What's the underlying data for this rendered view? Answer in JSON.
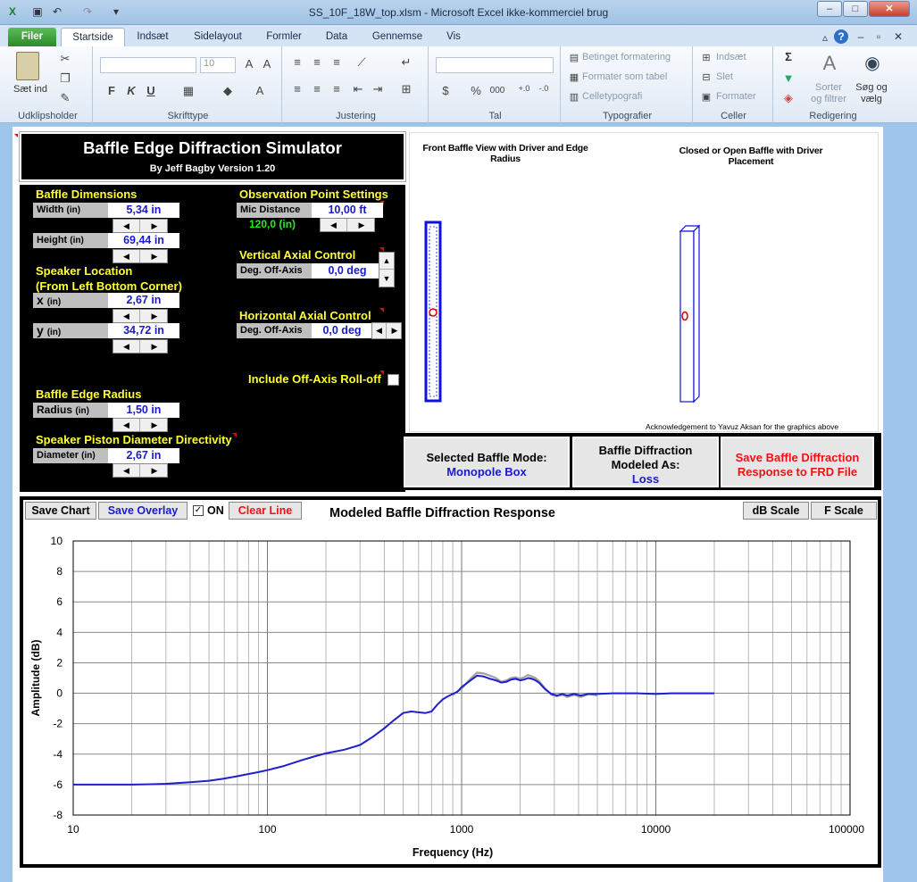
{
  "window": {
    "title": "SS_10F_18W_top.xlsm  -  Microsoft Excel ikke-kommerciel brug",
    "min": "–",
    "max": "□",
    "close": "✕"
  },
  "ribbon": {
    "tabs": [
      "Filer",
      "Startside",
      "Indsæt",
      "Sidelayout",
      "Formler",
      "Data",
      "Gennemse",
      "Vis"
    ],
    "clipboard": {
      "paste": "Sæt ind",
      "label": "Udklipsholder"
    },
    "font": {
      "label": "Skrifttype",
      "size": "10",
      "bold": "F",
      "italic": "K",
      "underline": "U"
    },
    "alignment": {
      "label": "Justering"
    },
    "number": {
      "label": "Tal",
      "percent": "%",
      "thousands": "000"
    },
    "styles": {
      "label": "Typografier",
      "conditional": "Betinget formatering",
      "table": "Formater som tabel",
      "cell_styles": "Celletypografi"
    },
    "cells": {
      "label": "Celler",
      "insert": "Indsæt",
      "delete": "Slet",
      "format": "Formater"
    },
    "editing": {
      "label": "Redigering",
      "sort": "Sorter og filtrer",
      "find": "Søg og vælg",
      "sum": "Σ"
    }
  },
  "sim": {
    "title": "Baffle Edge Diffraction Simulator",
    "byline": "By Jeff Bagby Version 1.20",
    "baffle_dims": "Baffle Dimensions",
    "width_label": "Width",
    "width_unit": "(in)",
    "width_value": "5,34 in",
    "height_label": "Height",
    "height_unit": "(in)",
    "height_value": "69,44 in",
    "speaker_location": "Speaker Location",
    "speaker_location_sub": "(From Left Bottom Corner)",
    "x_label": "x",
    "x_unit": "(in)",
    "x_value": "2,67 in",
    "y_label": "y",
    "y_unit": "(in)",
    "y_value": "34,72 in",
    "edge_radius": "Baffle Edge Radius",
    "radius_label": "Radius",
    "radius_unit": "(in)",
    "radius_value": "1,50 in",
    "piston": "Speaker Piston Diameter Directivity",
    "diameter_label": "Diameter",
    "diameter_unit": "(in)",
    "diameter_value": "2,67 in",
    "obs_settings": "Observation Point Settings",
    "mic_label": "Mic Distance",
    "mic_value": "10,00 ft",
    "mic_inches": "120,0 (in)",
    "vert_control": "Vertical Axial Control",
    "vert_label": "Deg. Off-Axis",
    "vert_value": "0,0 deg",
    "horiz_control": "Horizontal Axial Control",
    "horiz_label": "Deg. Off-Axis",
    "horiz_value": "0,0 deg",
    "rolloff": "Include Off-Axis Roll-off"
  },
  "graphics": {
    "front_caption": "Front Baffle View with Driver and Edge Radius",
    "closed_caption": "Closed or Open Baffle with Driver Placement",
    "ack": "Acknowledgement to Yavuz Aksan for the graphics above"
  },
  "mode": {
    "selected_label": "Selected Baffle Mode:",
    "selected_value": "Monopole Box",
    "modeled_label": "Baffle Diffraction Modeled As:",
    "modeled_value": "Loss",
    "save_frd": "Save Baffle Diffraction Response to FRD File"
  },
  "chart_buttons": {
    "save_chart": "Save Chart",
    "save_overlay": "Save Overlay",
    "on_check": "✓",
    "on_label": "ON",
    "clear_line": "Clear Line",
    "db_scale": "dB Scale",
    "f_scale": "F Scale"
  },
  "colors": {
    "primary_line": "#1f1fcc",
    "overlay_line": "#a0a0a0",
    "accent_yellow": "#ffff33",
    "accent_green": "#22ee22"
  },
  "chart_data": {
    "type": "line",
    "title": "Modeled Baffle Diffraction Response",
    "xlabel": "Frequency (Hz)",
    "ylabel": "Amplitude (dB)",
    "xscale": "log",
    "xlim": [
      10,
      100000
    ],
    "ylim": [
      -8,
      10
    ],
    "xticks": [
      10,
      100,
      1000,
      10000,
      100000
    ],
    "xtick_labels": [
      "10",
      "100",
      "1000",
      "10000",
      "100000"
    ],
    "yticks": [
      -8,
      -6,
      -4,
      -2,
      0,
      2,
      4,
      6,
      8,
      10
    ],
    "ytick_labels": [
      "-8",
      "-6",
      "-4",
      "-2",
      "0",
      "2",
      "4",
      "6",
      "8",
      "10"
    ],
    "grid": true,
    "series": [
      {
        "role": "overlay",
        "color": "#a0a0a0",
        "x": [
          900,
          1000,
          1100,
          1200,
          1300,
          1400,
          1500,
          1600,
          1700,
          1800,
          1900,
          2000,
          2100,
          2200,
          2300,
          2400,
          2500,
          2700,
          2900,
          3100,
          3300,
          3500,
          3800,
          4100,
          4500,
          5000
        ],
        "y": [
          -0.1,
          0.3,
          0.9,
          1.35,
          1.3,
          1.15,
          1.0,
          0.75,
          0.85,
          1.0,
          1.05,
          0.95,
          1.05,
          1.2,
          1.1,
          1.0,
          0.8,
          0.3,
          -0.1,
          -0.2,
          -0.1,
          -0.25,
          -0.1,
          -0.25,
          -0.05,
          -0.15
        ]
      },
      {
        "role": "primary",
        "color": "#1f1fcc",
        "x": [
          10,
          15,
          20,
          25,
          30,
          40,
          50,
          60,
          70,
          80,
          90,
          100,
          120,
          150,
          180,
          200,
          250,
          300,
          350,
          400,
          450,
          500,
          550,
          600,
          650,
          700,
          750,
          800,
          850,
          900,
          950,
          1000,
          1100,
          1200,
          1300,
          1400,
          1500,
          1600,
          1700,
          1800,
          1900,
          2000,
          2100,
          2200,
          2300,
          2400,
          2500,
          2700,
          2900,
          3100,
          3300,
          3500,
          3800,
          4100,
          4500,
          5000,
          6000,
          8000,
          10000,
          12000,
          15000,
          20000
        ],
        "y": [
          -6.0,
          -6.0,
          -6.0,
          -5.98,
          -5.95,
          -5.85,
          -5.75,
          -5.6,
          -5.45,
          -5.3,
          -5.18,
          -5.05,
          -4.8,
          -4.4,
          -4.1,
          -3.95,
          -3.7,
          -3.4,
          -2.85,
          -2.3,
          -1.75,
          -1.3,
          -1.2,
          -1.25,
          -1.3,
          -1.2,
          -0.75,
          -0.4,
          -0.2,
          -0.05,
          0.1,
          0.4,
          0.8,
          1.15,
          1.1,
          0.95,
          0.85,
          0.7,
          0.75,
          0.9,
          0.95,
          0.85,
          0.9,
          1.0,
          0.95,
          0.85,
          0.7,
          0.25,
          -0.05,
          -0.15,
          -0.05,
          -0.15,
          -0.05,
          -0.15,
          -0.05,
          -0.05,
          0.0,
          0.0,
          -0.05,
          0.0,
          0.0,
          0.0
        ]
      }
    ]
  }
}
